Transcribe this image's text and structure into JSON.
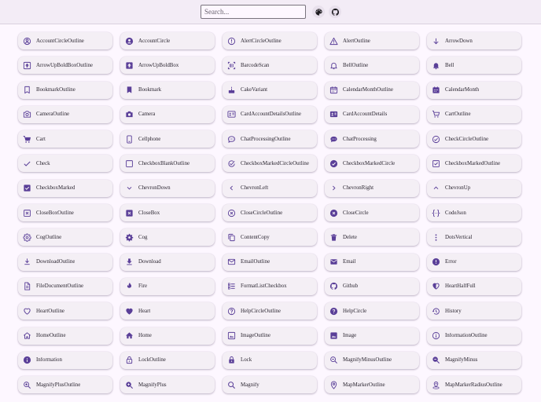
{
  "header": {
    "search_placeholder": "Search...",
    "palette_icon": "palette-icon",
    "github_icon": "github-icon"
  },
  "colors": {
    "accent": "#5a3f98",
    "card": "#f4eff5",
    "background": "#fdf7ff"
  },
  "icons": [
    {
      "label": "AccountCircleOutline",
      "icon": "account-circle-outline-icon"
    },
    {
      "label": "AccountCircle",
      "icon": "account-circle-icon"
    },
    {
      "label": "AlertCircleOutline",
      "icon": "alert-circle-outline-icon"
    },
    {
      "label": "AlertOutline",
      "icon": "alert-outline-icon"
    },
    {
      "label": "ArrowDown",
      "icon": "arrow-down-icon"
    },
    {
      "label": "ArrowUpBoldBoxOutline",
      "icon": "arrow-up-bold-box-outline-icon"
    },
    {
      "label": "ArrowUpBoldBox",
      "icon": "arrow-up-bold-box-icon"
    },
    {
      "label": "BarcodeScan",
      "icon": "barcode-scan-icon"
    },
    {
      "label": "BellOutline",
      "icon": "bell-outline-icon"
    },
    {
      "label": "Bell",
      "icon": "bell-icon"
    },
    {
      "label": "BookmarkOutline",
      "icon": "bookmark-outline-icon"
    },
    {
      "label": "Bookmark",
      "icon": "bookmark-icon"
    },
    {
      "label": "CakeVariant",
      "icon": "cake-variant-icon"
    },
    {
      "label": "CalendarMonthOutline",
      "icon": "calendar-month-outline-icon"
    },
    {
      "label": "CalendarMonth",
      "icon": "calendar-month-icon"
    },
    {
      "label": "CameraOutline",
      "icon": "camera-outline-icon"
    },
    {
      "label": "Camera",
      "icon": "camera-icon"
    },
    {
      "label": "CardAccountDetailsOutline",
      "icon": "card-account-details-outline-icon"
    },
    {
      "label": "CardAccountDetails",
      "icon": "card-account-details-icon"
    },
    {
      "label": "CartOutline",
      "icon": "cart-outline-icon"
    },
    {
      "label": "Cart",
      "icon": "cart-icon"
    },
    {
      "label": "Cellphone",
      "icon": "cellphone-icon"
    },
    {
      "label": "ChatProcessingOutline",
      "icon": "chat-processing-outline-icon"
    },
    {
      "label": "ChatProcessing",
      "icon": "chat-processing-icon"
    },
    {
      "label": "CheckCircleOutline",
      "icon": "check-circle-outline-icon"
    },
    {
      "label": "Check",
      "icon": "check-icon"
    },
    {
      "label": "CheckboxBlankOutline",
      "icon": "checkbox-blank-outline-icon"
    },
    {
      "label": "CheckboxMarkedCircleOutline",
      "icon": "checkbox-marked-circle-outline-icon"
    },
    {
      "label": "CheckboxMarkedCircle",
      "icon": "checkbox-marked-circle-icon"
    },
    {
      "label": "CheckboxMarkedOutline",
      "icon": "checkbox-marked-outline-icon"
    },
    {
      "label": "CheckboxMarked",
      "icon": "checkbox-marked-icon"
    },
    {
      "label": "ChevronDown",
      "icon": "chevron-down-icon"
    },
    {
      "label": "ChevronLeft",
      "icon": "chevron-left-icon"
    },
    {
      "label": "ChevronRight",
      "icon": "chevron-right-icon"
    },
    {
      "label": "ChevronUp",
      "icon": "chevron-up-icon"
    },
    {
      "label": "CloseBoxOutline",
      "icon": "close-box-outline-icon"
    },
    {
      "label": "CloseBox",
      "icon": "close-box-icon"
    },
    {
      "label": "CloseCircleOutline",
      "icon": "close-circle-outline-icon"
    },
    {
      "label": "CloseCircle",
      "icon": "close-circle-icon"
    },
    {
      "label": "CodeJson",
      "icon": "code-json-icon"
    },
    {
      "label": "CogOutline",
      "icon": "cog-outline-icon"
    },
    {
      "label": "Cog",
      "icon": "cog-icon"
    },
    {
      "label": "ContentCopy",
      "icon": "content-copy-icon"
    },
    {
      "label": "Delete",
      "icon": "delete-icon"
    },
    {
      "label": "DotsVertical",
      "icon": "dots-vertical-icon"
    },
    {
      "label": "DownloadOutline",
      "icon": "download-outline-icon"
    },
    {
      "label": "Download",
      "icon": "download-icon"
    },
    {
      "label": "EmailOutline",
      "icon": "email-outline-icon"
    },
    {
      "label": "Email",
      "icon": "email-icon"
    },
    {
      "label": "Error",
      "icon": "error-icon"
    },
    {
      "label": "FileDocumentOutline",
      "icon": "file-document-outline-icon"
    },
    {
      "label": "Fire",
      "icon": "fire-icon"
    },
    {
      "label": "FormatListCheckbox",
      "icon": "format-list-checkbox-icon"
    },
    {
      "label": "Github",
      "icon": "github-icon"
    },
    {
      "label": "HeartHalfFull",
      "icon": "heart-half-full-icon"
    },
    {
      "label": "HeartOutline",
      "icon": "heart-outline-icon"
    },
    {
      "label": "Heart",
      "icon": "heart-icon"
    },
    {
      "label": "HelpCircleOutline",
      "icon": "help-circle-outline-icon"
    },
    {
      "label": "HelpCircle",
      "icon": "help-circle-icon"
    },
    {
      "label": "History",
      "icon": "history-icon"
    },
    {
      "label": "HomeOutline",
      "icon": "home-outline-icon"
    },
    {
      "label": "Home",
      "icon": "home-icon"
    },
    {
      "label": "ImageOutline",
      "icon": "image-outline-icon"
    },
    {
      "label": "Image",
      "icon": "image-icon"
    },
    {
      "label": "InformationOutline",
      "icon": "information-outline-icon"
    },
    {
      "label": "Information",
      "icon": "information-icon"
    },
    {
      "label": "LockOutline",
      "icon": "lock-outline-icon"
    },
    {
      "label": "Lock",
      "icon": "lock-icon"
    },
    {
      "label": "MagnifyMinusOutline",
      "icon": "magnify-minus-outline-icon"
    },
    {
      "label": "MagnifyMinus",
      "icon": "magnify-minus-icon"
    },
    {
      "label": "MagnifyPlusOutline",
      "icon": "magnify-plus-outline-icon"
    },
    {
      "label": "MagnifyPlus",
      "icon": "magnify-plus-icon"
    },
    {
      "label": "Magnify",
      "icon": "magnify-icon"
    },
    {
      "label": "MapMarkerOutline",
      "icon": "map-marker-outline-icon"
    },
    {
      "label": "MapMarkerRadiusOutline",
      "icon": "map-marker-radius-outline-icon"
    }
  ]
}
